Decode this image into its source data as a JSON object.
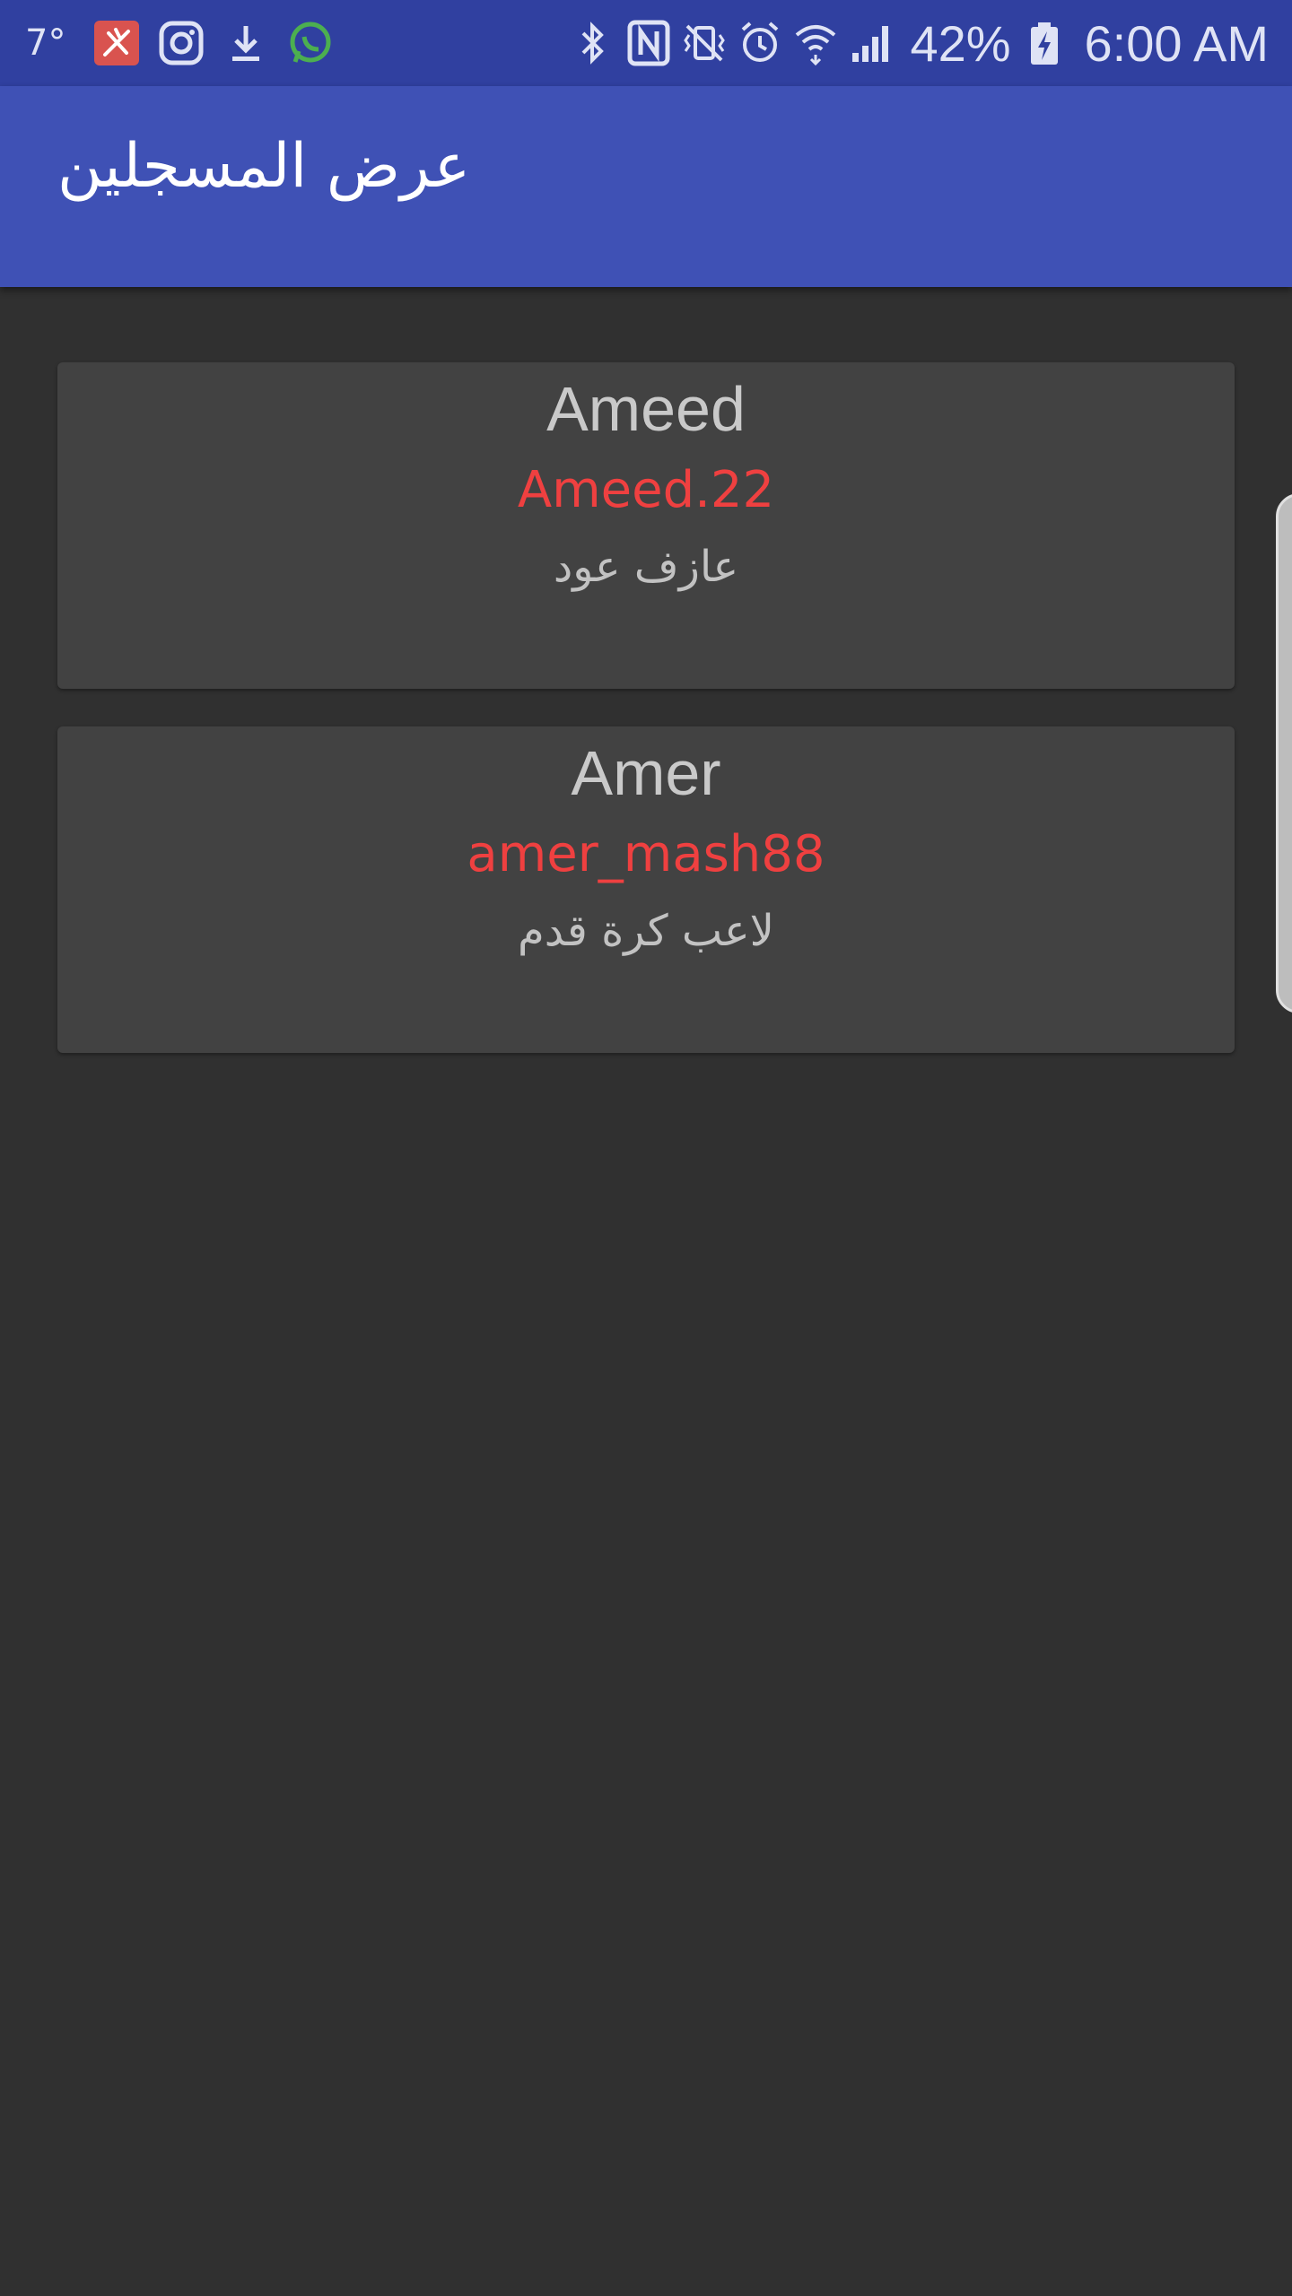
{
  "status_bar": {
    "temperature": "7°",
    "left_icons": [
      "clean-master-icon",
      "instagram-icon",
      "download-icon",
      "whatsapp-icon"
    ],
    "right_icons": [
      "bluetooth-icon",
      "nfc-icon",
      "vibrate-icon",
      "alarm-icon",
      "wifi-icon",
      "signal-icon",
      "battery-charging-icon"
    ],
    "battery_percent": "42%",
    "time": "6:00 AM"
  },
  "app_bar": {
    "title": "عرض المسجلين"
  },
  "users": [
    {
      "name": "Ameed",
      "handle": "Ameed.22",
      "description": "عازف عود"
    },
    {
      "name": "Amer",
      "handle": "amer_mash88",
      "description": "لاعب كرة قدم"
    }
  ],
  "colors": {
    "status_bar": "#3040a0",
    "app_bar": "#3f51b5",
    "background": "#303030",
    "card": "#424242",
    "handle_text": "#ef4040"
  }
}
